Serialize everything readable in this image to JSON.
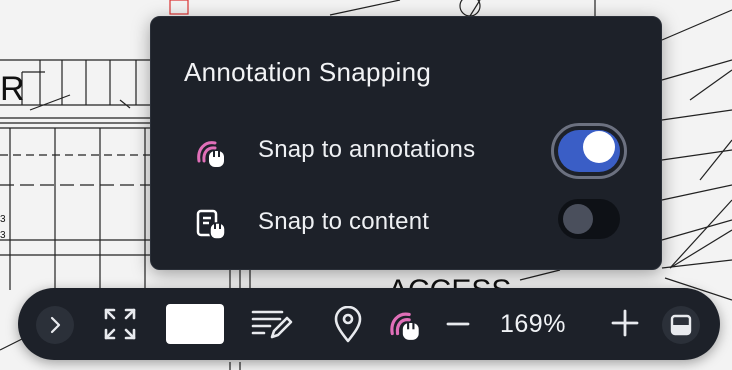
{
  "background": {
    "drawing_label_partial": "ACCESS",
    "drawing_label_left": "R"
  },
  "popover": {
    "title": "Annotation Snapping",
    "options": [
      {
        "label": "Snap to annotations",
        "icon": "magnet-annotation-icon",
        "enabled": true
      },
      {
        "label": "Snap to content",
        "icon": "magnet-content-icon",
        "enabled": false
      }
    ]
  },
  "toolbar": {
    "expand_icon": "chevron-right-icon",
    "fit_icon": "fit-screen-icon",
    "swatch_color": "#ffffff",
    "notes_icon": "lines-pencil-icon",
    "pin_icon": "location-pin-icon",
    "snap_icon": "magnet-annotation-icon",
    "zoom_out_icon": "minus-icon",
    "zoom_level": "169%",
    "zoom_in_icon": "plus-icon",
    "panel_icon": "panel-toggle-icon"
  },
  "colors": {
    "panel_bg": "#1d2129",
    "toggle_on": "#3a5ec6",
    "snap_icon_pink": "#e06fb8"
  }
}
